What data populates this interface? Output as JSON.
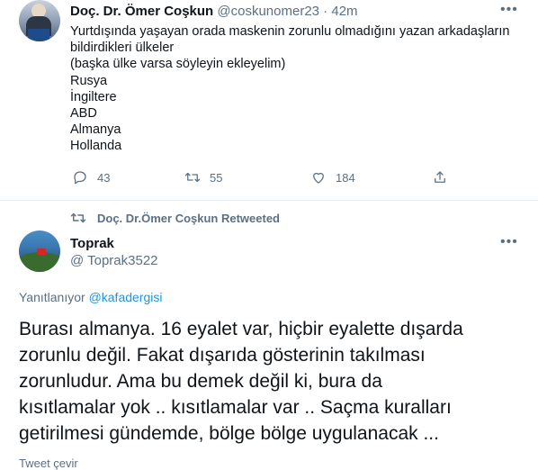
{
  "tweet": {
    "author_name": "Doç. Dr. Ömer Coşkun",
    "author_handle": "@coskunomer23",
    "separator": " · ",
    "time": "42m",
    "lines": [
      "Yurtdışında yaşayan orada maskenin zorunlu olmadığını  yazan  arkadaşların",
      "bildirdikleri ülkeler",
      "(başka ülke varsa söyleyin ekleyelim)",
      "Rusya",
      "İngiltere",
      "ABD",
      "Almanya",
      "Hollanda"
    ],
    "replies": "43",
    "retweets": "55",
    "likes": "184"
  },
  "retweet_banner": {
    "text": "Doç. Dr.Ömer Coşkun Retweeted"
  },
  "retweeted_tweet": {
    "author_name": "Toprak",
    "author_handle": "@ Toprak3522",
    "replying_prefix": "Yanıtlanıyor ",
    "replying_to": "@kafadergisi",
    "lines": [
      "Burası almanya. 16 eyalet var, hiçbir eyalette dışarda",
      "zorunlu değil. Fakat dışarıda gösterinin takılması",
      "zorunludur. Ama bu demek değil ki, bura da",
      "kısıtlamalar yok .. kısıtlamalar var .. Saçma kuralları",
      "getirilmesi gündemde, bölge bölge uygulanacak ..."
    ],
    "cut_text": "Tweet çevir"
  },
  "icons": {
    "avatar1": "profile-photo-speaker",
    "avatar2": "profile-photo-landscape",
    "more": "more-dots-icon",
    "reply": "reply-icon",
    "retweet": "retweet-icon",
    "like": "heart-icon",
    "share": "share-icon"
  },
  "colors": {
    "text": "#0f1419",
    "muted": "#5b7083",
    "link": "#1b95e0",
    "divider": "#e6ecf0"
  }
}
